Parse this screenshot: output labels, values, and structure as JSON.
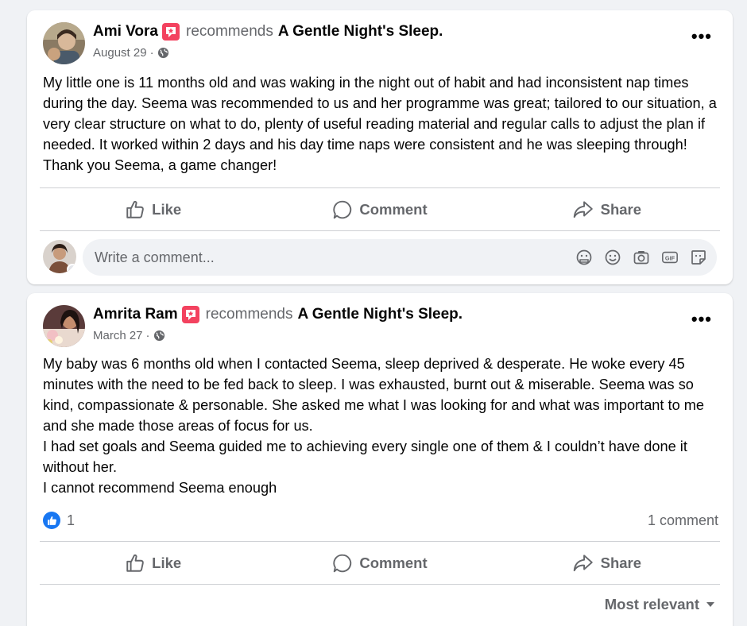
{
  "posts": [
    {
      "author": "Ami Vora",
      "recommends_label": "recommends",
      "page_name": "A Gentle Night's Sleep.",
      "date": "August 29",
      "date_separator": "·",
      "body": [
        "My little one is 11 months old and was waking in the night out of habit and had inconsistent nap times during the day. Seema was recommended to us and her programme was great; tailored to our situation, a very clear structure on what to do, plenty of useful reading material and regular calls to adjust the plan if needed. It worked within 2 days and his day time naps were consistent and he was sleeping through! Thank you Seema, a game changer!"
      ],
      "actions": {
        "like": "Like",
        "comment": "Comment",
        "share": "Share"
      },
      "comment_placeholder": "Write a comment..."
    },
    {
      "author": "Amrita Ram",
      "recommends_label": "recommends",
      "page_name": "A Gentle Night's Sleep.",
      "date": "March 27",
      "date_separator": "·",
      "body": [
        "My baby was 6 months old when I contacted Seema, sleep deprived & desperate. He woke every 45 minutes with the need to be fed back to sleep. I was exhausted, burnt out & miserable. Seema was so kind, compassionate & personable. She asked me what I was looking for and what was important to me and she made those areas of focus for us.",
        "I had set goals and Seema guided me to achieving every single one of them & I couldn’t have done it without her.",
        "I cannot recommend Seema enough"
      ],
      "reaction_count": "1",
      "comment_count": "1 comment",
      "actions": {
        "like": "Like",
        "comment": "Comment",
        "share": "Share"
      },
      "sort_label": "Most relevant"
    }
  ],
  "icons": {
    "more": "more-horizontal-icon",
    "globe": "globe-icon",
    "like": "thumbs-up-icon",
    "comment": "speech-bubble-icon",
    "share": "share-arrow-icon",
    "sticker": "sticker-icon",
    "emoji": "emoji-icon",
    "camera": "camera-icon",
    "gif": "gif-icon",
    "avatar_sticker": "avatar-sticker-icon",
    "recommend_star": "recommend-star-icon"
  },
  "colors": {
    "page_background": "#f0f2f5",
    "card": "#ffffff",
    "text_primary": "#050505",
    "text_secondary": "#65676b",
    "recommend_badge": "#f3425f",
    "like_blue": "#1877f2"
  }
}
